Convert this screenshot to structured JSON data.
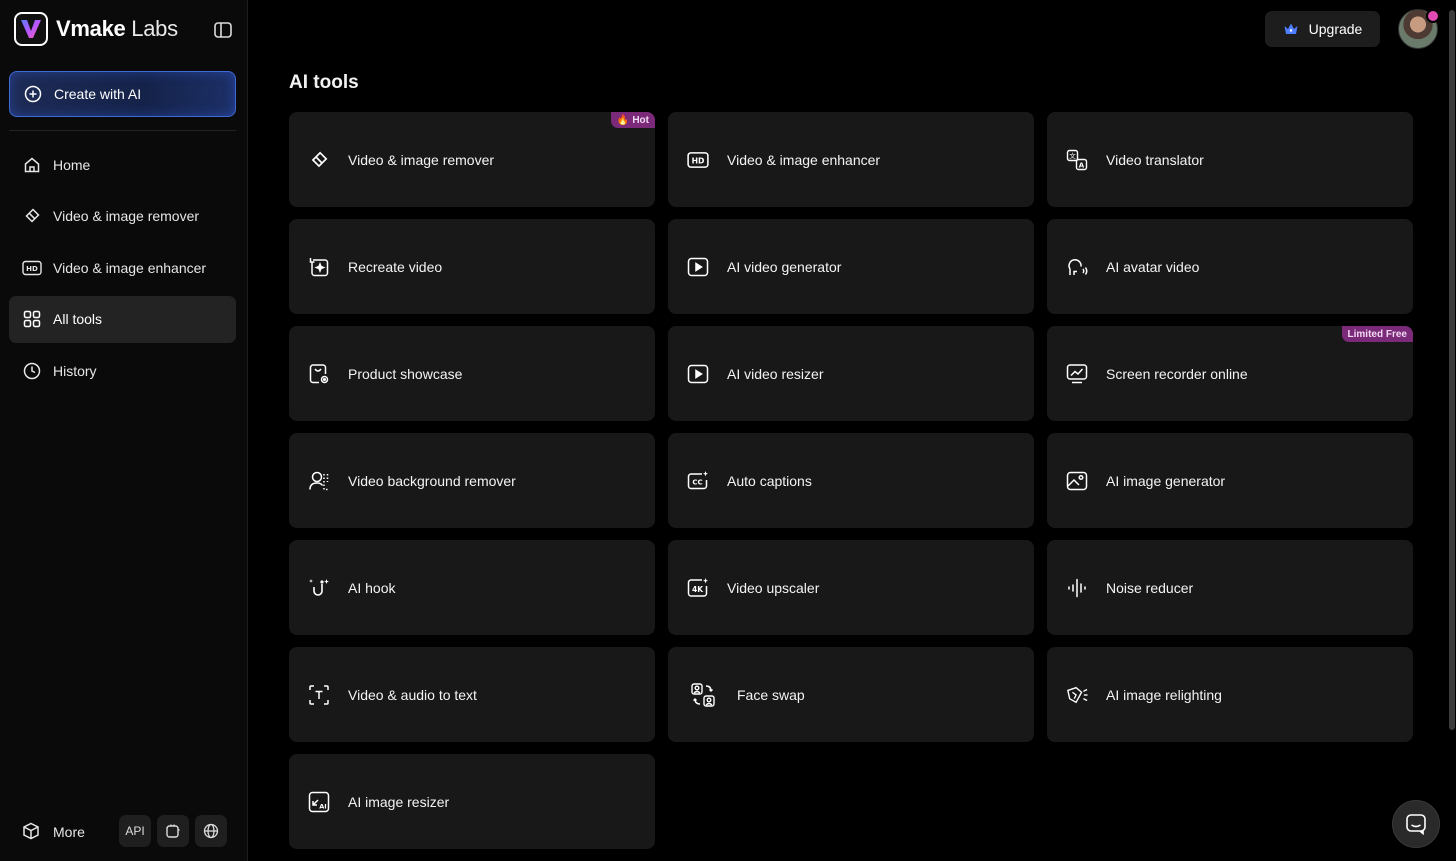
{
  "brand": {
    "name": "Vmake",
    "suffix": "Labs"
  },
  "sidebar": {
    "create_label": "Create with AI",
    "items": [
      {
        "label": "Home",
        "icon": "home-icon"
      },
      {
        "label": "Video & image remover",
        "icon": "eraser-icon"
      },
      {
        "label": "Video & image enhancer",
        "icon": "hd-icon"
      },
      {
        "label": "All tools",
        "icon": "grid-icon",
        "active": true
      },
      {
        "label": "History",
        "icon": "clock-icon"
      }
    ],
    "more_label": "More",
    "api_label": "API"
  },
  "header": {
    "upgrade_label": "Upgrade"
  },
  "main": {
    "title": "AI tools",
    "tools": [
      {
        "label": "Video & image remover",
        "icon": "eraser-icon",
        "badge": "Hot"
      },
      {
        "label": "Video & image enhancer",
        "icon": "hd-icon"
      },
      {
        "label": "Video translator",
        "icon": "translate-icon"
      },
      {
        "label": "Recreate video",
        "icon": "recreate-icon"
      },
      {
        "label": "AI video generator",
        "icon": "play-square-icon"
      },
      {
        "label": "AI avatar video",
        "icon": "avatar-voice-icon"
      },
      {
        "label": "Product showcase",
        "icon": "bag-icon"
      },
      {
        "label": "AI video resizer",
        "icon": "play-square-icon"
      },
      {
        "label": "Screen recorder online",
        "icon": "screen-recorder-icon",
        "badge": "Limited Free"
      },
      {
        "label": "Video background remover",
        "icon": "person-bg-icon"
      },
      {
        "label": "Auto captions",
        "icon": "cc-icon"
      },
      {
        "label": "AI image generator",
        "icon": "image-icon"
      },
      {
        "label": "AI hook",
        "icon": "hook-icon"
      },
      {
        "label": "Video upscaler",
        "icon": "4k-icon"
      },
      {
        "label": "Noise reducer",
        "icon": "waveform-icon"
      },
      {
        "label": "Video & audio to text",
        "icon": "text-scan-icon"
      },
      {
        "label": "Face swap",
        "icon": "face-swap-icon"
      },
      {
        "label": "AI image relighting",
        "icon": "relight-icon"
      },
      {
        "label": "AI image resizer",
        "icon": "ai-resize-icon"
      }
    ]
  },
  "colors": {
    "accent": "#3f69d6",
    "badge": "#7a2a78",
    "card": "#181818"
  }
}
